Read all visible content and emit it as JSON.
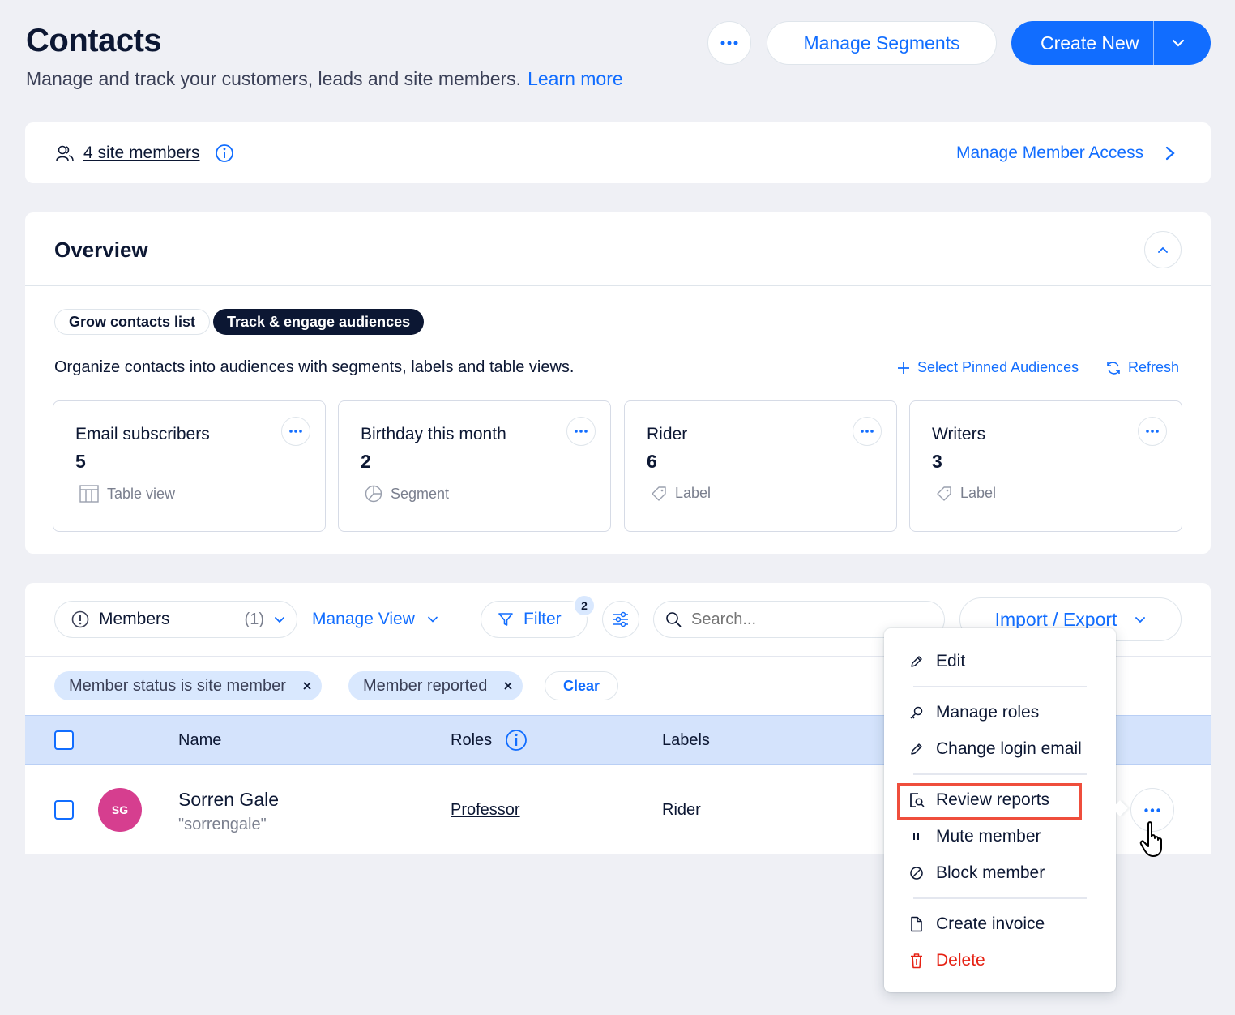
{
  "page": {
    "title": "Contacts",
    "subtitle": "Manage and track your customers, leads and site members.",
    "learn_more": "Learn more"
  },
  "header": {
    "manage_segments": "Manage Segments",
    "create_new": "Create New"
  },
  "members_strip": {
    "link": "4 site members",
    "manage_access": "Manage Member Access"
  },
  "overview": {
    "title": "Overview",
    "tabs": [
      "Grow contacts list",
      "Track & engage audiences"
    ],
    "description": "Organize contacts into audiences with segments, labels and table views.",
    "select_pinned": "Select Pinned Audiences",
    "refresh": "Refresh",
    "audiences": [
      {
        "title": "Email subscribers",
        "count": "5",
        "kind": "Table view",
        "icon": "table-icon"
      },
      {
        "title": "Birthday this month",
        "count": "2",
        "kind": "Segment",
        "icon": "pie-icon"
      },
      {
        "title": "Rider",
        "count": "6",
        "kind": "Label",
        "icon": "tag-icon"
      },
      {
        "title": "Writers",
        "count": "3",
        "kind": "Label",
        "icon": "tag-icon"
      }
    ]
  },
  "toolbar": {
    "view_select": "Members",
    "view_count": "(1)",
    "manage_view": "Manage View",
    "filter": "Filter",
    "filter_count": "2",
    "search_placeholder": "Search...",
    "import_export": "Import / Export"
  },
  "filters": {
    "chips": [
      "Member status is site member",
      "Member reported"
    ],
    "clear": "Clear"
  },
  "table": {
    "columns": {
      "name": "Name",
      "roles": "Roles",
      "labels": "Labels"
    },
    "rows": [
      {
        "initials": "SG",
        "name": "Sorren Gale",
        "username": "\"sorrengale\"",
        "role": "Professor",
        "label": "Rider"
      }
    ]
  },
  "menu": {
    "edit": "Edit",
    "manage_roles": "Manage roles",
    "change_login_email": "Change login email",
    "review_reports": "Review reports",
    "mute_member": "Mute member",
    "block_member": "Block member",
    "create_invoice": "Create invoice",
    "delete": "Delete"
  },
  "colors": {
    "accent": "#116dff",
    "danger": "#e62214",
    "avatar": "#d63e8f",
    "highlight": "#ef4e3c"
  }
}
